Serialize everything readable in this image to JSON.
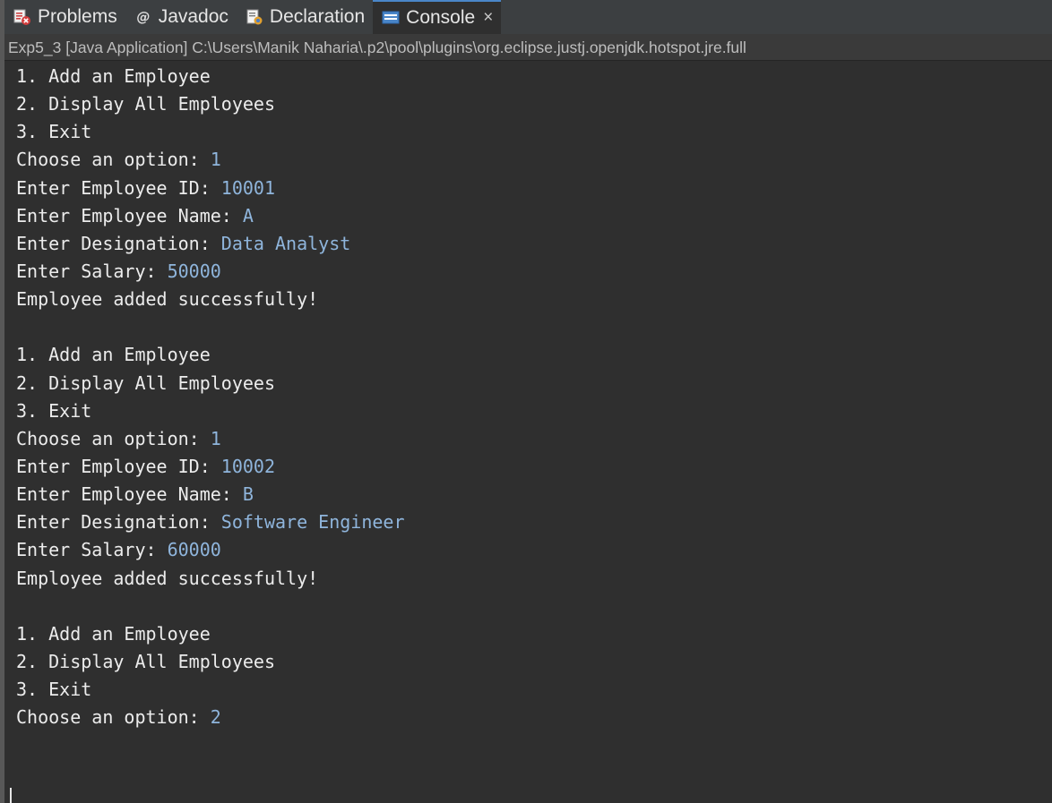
{
  "tabs": [
    {
      "label": "Problems",
      "icon": "problems-icon",
      "active": false
    },
    {
      "label": "Javadoc",
      "icon": "javadoc-icon",
      "active": false
    },
    {
      "label": "Declaration",
      "icon": "declaration-icon",
      "active": false
    },
    {
      "label": "Console",
      "icon": "console-icon",
      "active": true
    }
  ],
  "close_glyph": "×",
  "process_label": "Exp5_3 [Java Application] C:\\Users\\Manik Naharia\\.p2\\pool\\plugins\\org.eclipse.justj.openjdk.hotspot.jre.full",
  "colors": {
    "output_text": "#ececec",
    "input_text": "#8fb5dc",
    "background": "#2f2f2f",
    "active_tab_accent": "#4a86c8"
  },
  "console_lines": [
    {
      "text": "1. Add an Employee",
      "input": ""
    },
    {
      "text": "2. Display All Employees",
      "input": ""
    },
    {
      "text": "3. Exit",
      "input": ""
    },
    {
      "text": "Choose an option: ",
      "input": "1"
    },
    {
      "text": "Enter Employee ID: ",
      "input": "10001"
    },
    {
      "text": "Enter Employee Name: ",
      "input": "A"
    },
    {
      "text": "Enter Designation: ",
      "input": "Data Analyst"
    },
    {
      "text": "Enter Salary: ",
      "input": "50000"
    },
    {
      "text": "Employee added successfully!",
      "input": ""
    },
    {
      "text": "",
      "input": ""
    },
    {
      "text": "1. Add an Employee",
      "input": ""
    },
    {
      "text": "2. Display All Employees",
      "input": ""
    },
    {
      "text": "3. Exit",
      "input": ""
    },
    {
      "text": "Choose an option: ",
      "input": "1"
    },
    {
      "text": "Enter Employee ID: ",
      "input": "10002"
    },
    {
      "text": "Enter Employee Name: ",
      "input": "B"
    },
    {
      "text": "Enter Designation: ",
      "input": "Software Engineer"
    },
    {
      "text": "Enter Salary: ",
      "input": "60000"
    },
    {
      "text": "Employee added successfully!",
      "input": ""
    },
    {
      "text": "",
      "input": ""
    },
    {
      "text": "1. Add an Employee",
      "input": ""
    },
    {
      "text": "2. Display All Employees",
      "input": ""
    },
    {
      "text": "3. Exit",
      "input": ""
    },
    {
      "text": "Choose an option: ",
      "input": "2"
    }
  ]
}
